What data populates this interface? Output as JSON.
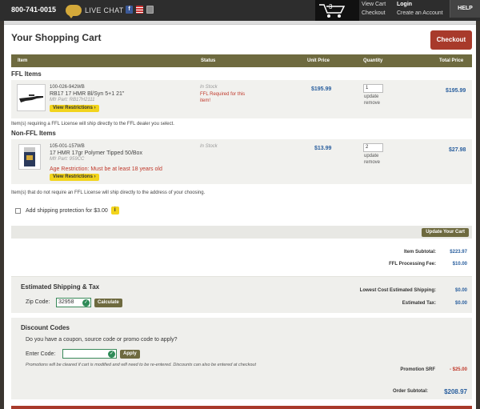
{
  "header": {
    "phone": "800-741-0015",
    "live_chat": "LIVE CHAT",
    "cart_count": "3",
    "view_cart": "View Cart",
    "checkout": "Checkout",
    "login": "Login",
    "create_account": "Create an Account",
    "help": "HELP"
  },
  "cart": {
    "title": "Your Shopping Cart",
    "checkout_button": "Checkout",
    "columns": [
      "Item",
      "Status",
      "Unit Price",
      "Quantity",
      "Total Price"
    ],
    "ffl_section": "FFL Items",
    "nonffl_section": "Non-FFL Items",
    "items": [
      {
        "sku": "100-026-942WB",
        "name": "RB17 17 HMR Bl/Syn 5+1 21\"",
        "mfr": "Mfr Part: RB17H2111",
        "restrictions": "View Restrictions ›",
        "status": "In Stock",
        "status_note": "FFL Required for this item!",
        "unit_price": "$195.99",
        "quantity": "1",
        "update": "update",
        "remove": "remove",
        "total": "$195.99"
      },
      {
        "sku": "105-001-157WB",
        "name": "17 HMR 17gr Polymer Tipped 50/Box",
        "mfr": "Mfr Part: 959CC",
        "age_restriction": "Age Restriction: Must be at least 18 years old",
        "restrictions": "View Restrictions ›",
        "status": "In Stock",
        "unit_price": "$13.99",
        "quantity": "2",
        "update": "update",
        "remove": "remove",
        "total": "$27.98"
      }
    ],
    "ffl_note": "Item(s) requiring a FFL License will ship directly to the FFL dealer you select.",
    "nonffl_note": "Item(s) that do not require an FFL License will ship directly to the address of your choosing.",
    "shipping_protection": "Add shipping protection for $3.00",
    "info_icon": "i",
    "update_cart": "Update Your Cart"
  },
  "summary": {
    "item_subtotal_label": "Item Subtotal:",
    "item_subtotal": "$223.97",
    "ffl_fee_label": "FFL Processing Fee:",
    "ffl_fee": "$10.00",
    "est_shipping_label": "Lowest Cost Estimated Shipping:",
    "est_shipping": "$0.00",
    "est_tax_label": "Estimated Tax:",
    "est_tax": "$0.00",
    "promo_label": "Promotion SRF",
    "promo_value": "- $25.00",
    "order_subtotal_label": "Order Subtotal:",
    "order_subtotal": "$208.97"
  },
  "shipping": {
    "title": "Estimated Shipping & Tax",
    "zip_label": "Zip Code:",
    "zip_value": "32958",
    "calculate": "Calculate"
  },
  "discount": {
    "title": "Discount Codes",
    "question": "Do you have a coupon, source code or promo code to apply?",
    "code_label": "Enter Code:",
    "code_value": "",
    "apply": "Apply",
    "note": "Promotions will be cleared if cart is modified and will need to be re-entered. Discounts can also be entered at checkout"
  },
  "colors": {
    "accent_red": "#a83a2b",
    "olive": "#6e6a3f",
    "price_blue": "#2a5f9e",
    "restriction_yellow": "#f2d41c"
  }
}
